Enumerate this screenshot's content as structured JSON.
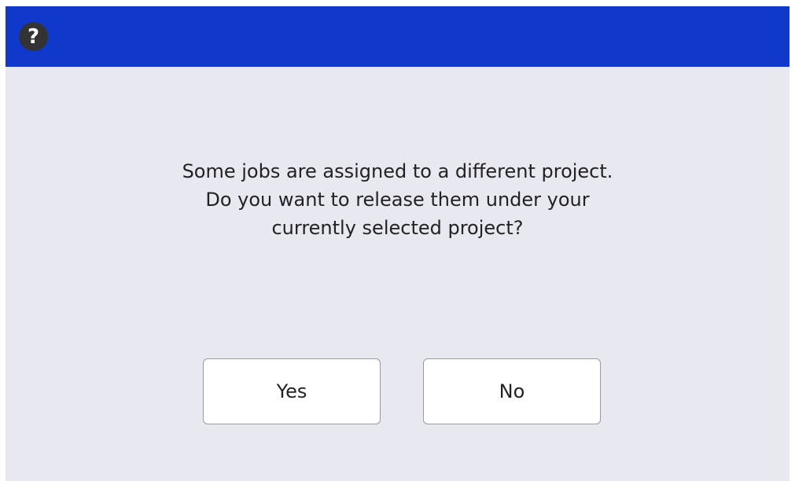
{
  "dialog": {
    "icon": "question-icon",
    "icon_glyph": "?",
    "message_lines": [
      "Some jobs are assigned to a different project.",
      "Do you want to release them under your",
      "currently selected project?"
    ],
    "buttons": {
      "yes_label": "Yes",
      "no_label": "No"
    }
  },
  "colors": {
    "titlebar": "#0e39cb",
    "background": "#e8e8f0",
    "button_bg": "#ffffff",
    "icon_bg": "#333333"
  }
}
